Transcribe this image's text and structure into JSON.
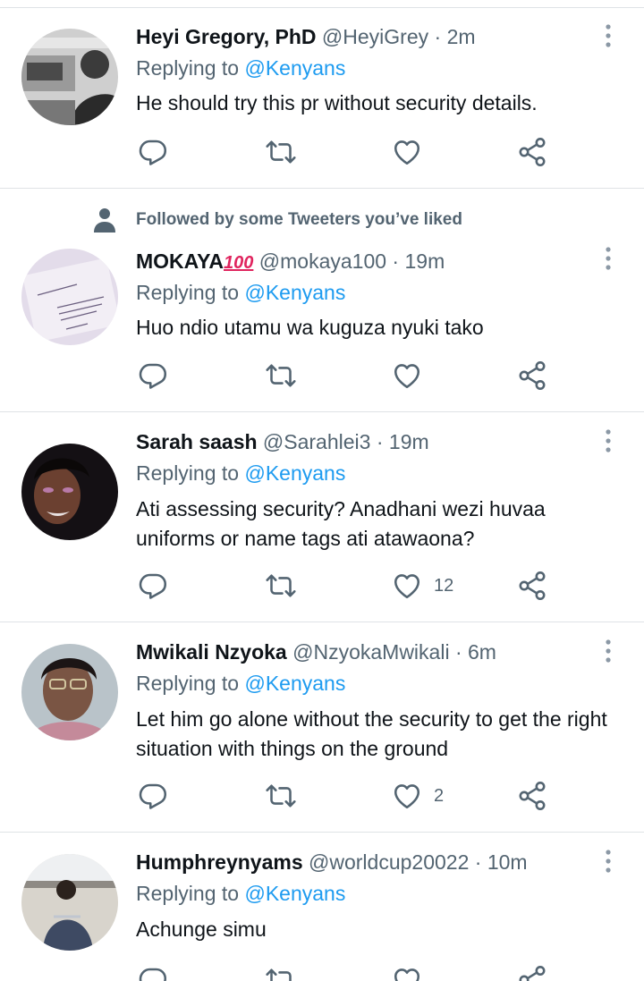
{
  "tweets": [
    {
      "name": "Heyi Gregory, PhD",
      "handle": "@HeyiGrey",
      "time": "2m",
      "replying_prefix": "Replying to",
      "replying_to": "@Kenyans",
      "text": "He should try this pr without security details.",
      "like_count": ""
    },
    {
      "social_context": "Followed by some Tweeters you’ve liked",
      "name": "MOKAYA",
      "name_emoji": "100",
      "handle": "@mokaya100",
      "time": "19m",
      "replying_prefix": "Replying to",
      "replying_to": "@Kenyans",
      "text": "Huo ndio utamu wa kuguza nyuki tako",
      "like_count": ""
    },
    {
      "name": "Sarah saash",
      "handle": "@Sarahlei3",
      "time": "19m",
      "replying_prefix": "Replying to",
      "replying_to": "@Kenyans",
      "text": "Ati assessing security? Anadhani wezi huvaa uniforms or name tags ati atawaona?",
      "like_count": "12"
    },
    {
      "name": "Mwikali Nzyoka",
      "handle": "@NzyokaMwikali",
      "time": "6m",
      "replying_prefix": "Replying to",
      "replying_to": "@Kenyans",
      "text": "Let him go alone without the security to get the right situation with things on the ground",
      "like_count": "2"
    },
    {
      "name": "Humphreynyams",
      "handle": "@worldcup20022",
      "time": "10m",
      "replying_prefix": "Replying to",
      "replying_to": "@Kenyans",
      "text": "Achunge simu",
      "like_count": ""
    }
  ],
  "separator": "·",
  "icons": [
    "reply-icon",
    "retweet-icon",
    "like-icon",
    "share-icon",
    "more-icon",
    "person-icon"
  ],
  "colors": {
    "text": "#0f1419",
    "secondary": "#536471",
    "link": "#1d9bf0",
    "divider": "#dfe3e6"
  }
}
